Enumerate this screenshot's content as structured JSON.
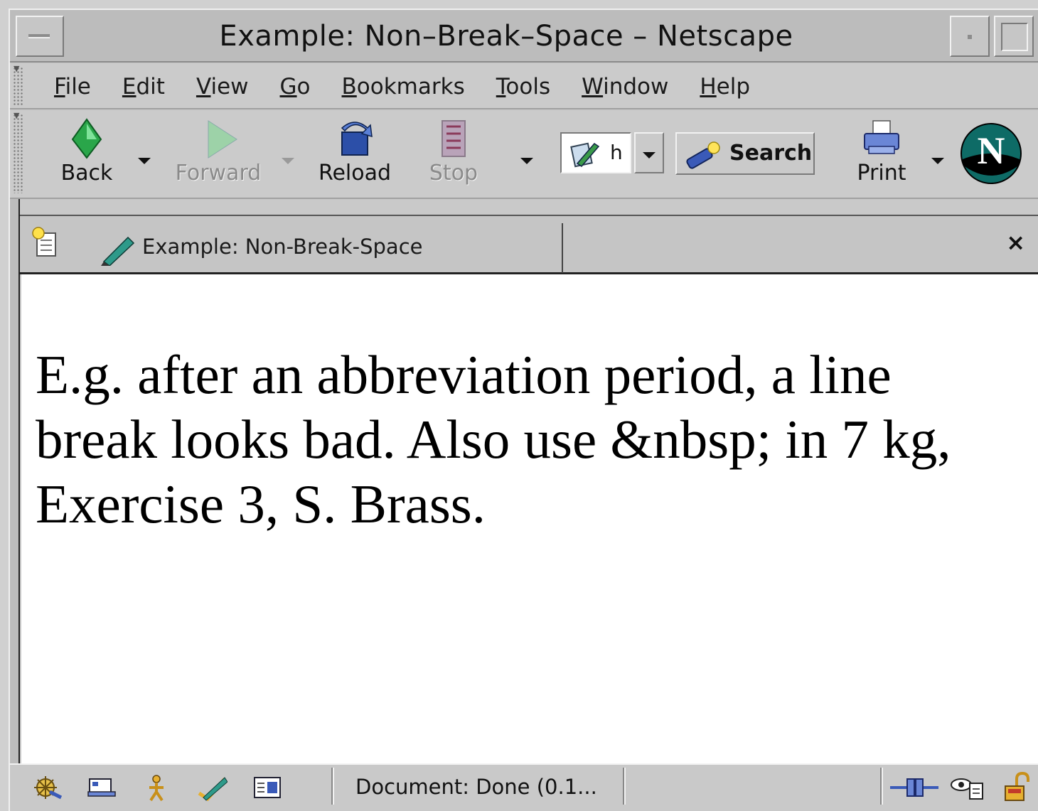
{
  "window": {
    "title": "Example: Non–Break–Space – Netscape"
  },
  "menu": {
    "items": [
      {
        "underline": "F",
        "rest": "ile"
      },
      {
        "underline": "E",
        "rest": "dit"
      },
      {
        "underline": "V",
        "rest": "iew"
      },
      {
        "underline": "G",
        "rest": "o"
      },
      {
        "underline": "B",
        "rest": "ookmarks"
      },
      {
        "underline": "T",
        "rest": "ools"
      },
      {
        "underline": "W",
        "rest": "indow"
      },
      {
        "underline": "H",
        "rest": "elp"
      }
    ]
  },
  "toolbar": {
    "back_label": "Back",
    "forward_label": "Forward",
    "reload_label": "Reload",
    "stop_label": "Stop",
    "url_value": "h",
    "search_label": "Search",
    "print_label": "Print",
    "forward_enabled": false,
    "stop_enabled": false,
    "brand_icon": "netscape-n-logo"
  },
  "tabs": {
    "active_title": "Example: Non-Break-Space",
    "close_glyph": "×"
  },
  "page": {
    "text": "E.g. after an abbreviation period, a line break looks bad. Also use &nbsp; in 7 kg, Exercise 3, S. Brass."
  },
  "status": {
    "text": "Document: Done (0.1...",
    "icons": [
      "navigator-icon",
      "mail-icon",
      "instant-messenger-icon",
      "composer-icon",
      "address-book-icon"
    ],
    "right_icons": [
      "online-connection-icon",
      "privacy-cookie-icon",
      "security-lock-icon"
    ]
  },
  "colors": {
    "chrome": "#c9c9c9",
    "content_bg": "#ffffff",
    "back_arrow": "#2aa64a",
    "netscape_logo": "#0e6b66"
  }
}
